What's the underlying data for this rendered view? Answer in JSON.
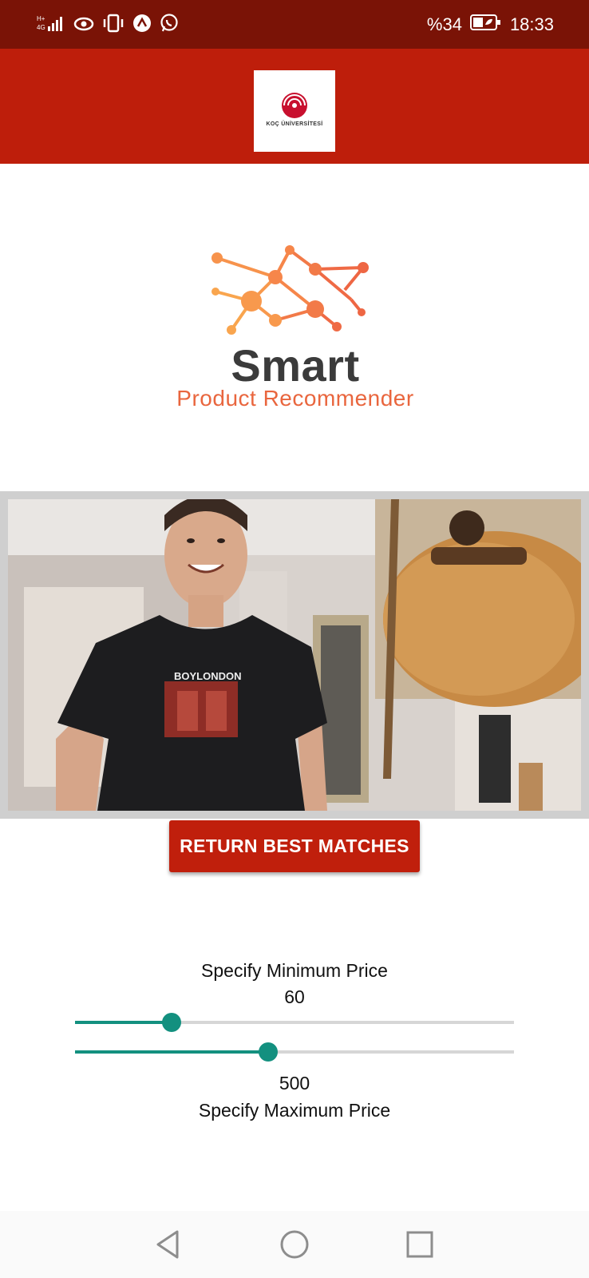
{
  "status_bar": {
    "battery_text": "%34",
    "time": "18:33",
    "icons": [
      "signal-icon",
      "eye-icon",
      "vibrate-icon",
      "app-notification-icon",
      "whatsapp-icon",
      "battery-icon"
    ]
  },
  "header": {
    "logo_text": "KOÇ ÜNİVERSİTESİ",
    "background_color": "#be1e0b"
  },
  "brand": {
    "title": "Smart",
    "subtitle": "Product Recommender",
    "title_color": "#3b3b3b",
    "subtitle_color": "#e9663e"
  },
  "camera": {
    "shirt_text": "BOYLONDON"
  },
  "actions": {
    "return_button_label": "RETURN BEST MATCHES"
  },
  "price": {
    "min_label": "Specify Minimum Price",
    "min_value": "60",
    "min_slider_fraction": 0.22,
    "max_value": "500",
    "max_label": "Specify Maximum Price",
    "max_slider_fraction": 0.44,
    "accent_color": "#13907f"
  },
  "nav_bar": {
    "buttons": [
      "back-icon",
      "home-icon",
      "recents-icon"
    ]
  }
}
